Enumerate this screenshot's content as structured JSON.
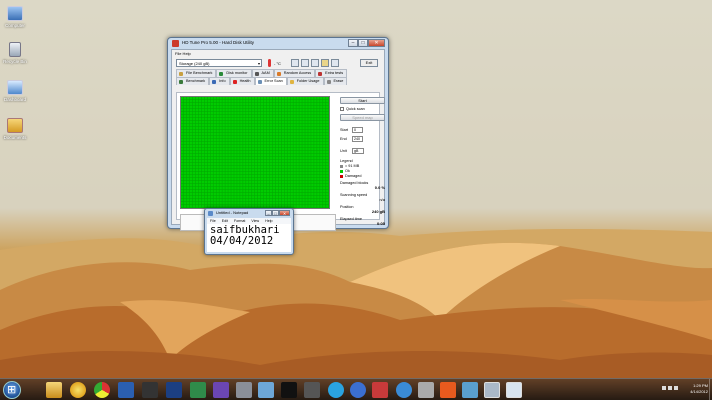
{
  "desktop": {
    "icons": [
      {
        "label": "Computer",
        "icon": "computer-icon"
      },
      {
        "label": "Recycle Bin",
        "icon": "recycle-bin-icon"
      },
      {
        "label": "Dashboard",
        "icon": "dashboard-icon"
      },
      {
        "label": "Documents",
        "icon": "folder-icon"
      }
    ]
  },
  "hdtune": {
    "title": "HD Tune Pro 5.00 - Hard Disk Utility",
    "menu": "File  Help",
    "drive": "Storage  (240 gB)",
    "temperature": "- °C",
    "exit_label": "Exit",
    "tabs_row1": [
      "File Benchmark",
      "Disk monitor",
      "AAM",
      "Random Access",
      "Extra tests"
    ],
    "tabs_row2": [
      "Benchmark",
      "Info",
      "Health",
      "Error Scan",
      "Folder Usage",
      "Erase"
    ],
    "active_tab": "Error Scan",
    "start_label": "Start",
    "quick_scan_label": "Quick scan",
    "speed_map_label": "Speed map",
    "start_label2": "Start",
    "start_value": "0",
    "end_label": "End",
    "end_value": "240",
    "unit_label": "Unit",
    "unit_value": "gB",
    "legend_title": "Legend",
    "legend_block": "= 91 MB",
    "legend_ok": "Ok",
    "legend_damaged": "Damaged",
    "damaged_blocks_label": "Damaged blocks",
    "damaged_blocks_value": "0.0 %",
    "scanning_speed_label": "Scanning speed",
    "scanning_speed_value": "n/a",
    "position_label": "Position",
    "position_value": "240 gB",
    "elapsed_label": "Elapsed time",
    "elapsed_value": "0:05",
    "colors": {
      "ok_block": "#00cc00",
      "damaged_block": "#cc0000"
    }
  },
  "notepad": {
    "title": "Untitled - Notepad",
    "menu": [
      "File",
      "Edit",
      "Format",
      "View",
      "Help"
    ],
    "text": "saifbukhari\n04/04/2012"
  },
  "taskbar": {
    "time": "1:29 PM",
    "date": "4/14/2012"
  }
}
